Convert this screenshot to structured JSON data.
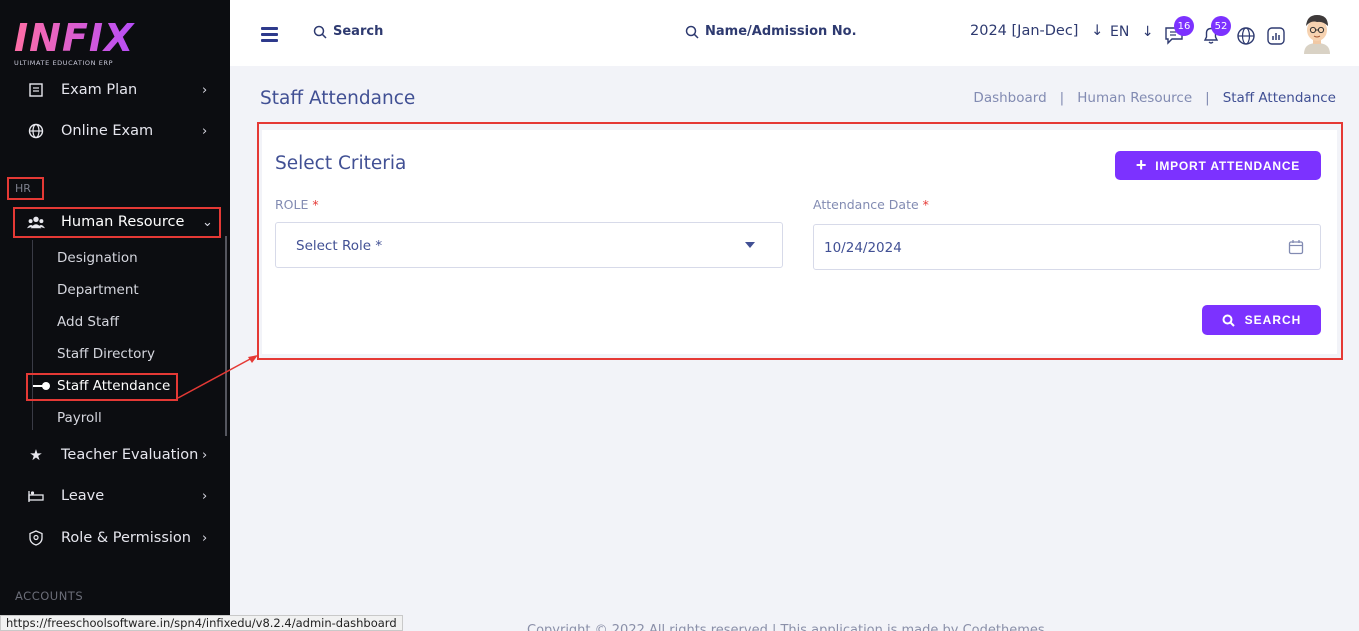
{
  "logo": {
    "main": "INFIX",
    "sub": "ULTIMATE EDUCATION ERP"
  },
  "sidebar": {
    "items_top": [
      {
        "label": "Exam Plan",
        "icon": "exam-plan-icon"
      },
      {
        "label": "Online Exam",
        "icon": "globe-icon"
      }
    ],
    "section_hr": "HR",
    "human_resource": {
      "label": "Human Resource",
      "icon": "users-icon"
    },
    "sub_items": [
      "Designation",
      "Department",
      "Add Staff",
      "Staff Directory",
      "Staff Attendance",
      "Payroll"
    ],
    "items_bottom": [
      {
        "label": "Teacher Evaluation",
        "icon": "star-icon"
      },
      {
        "label": "Leave",
        "icon": "leave-icon"
      },
      {
        "label": "Role & Permission",
        "icon": "permission-icon"
      }
    ],
    "section_accounts": "ACCOUNTS"
  },
  "topbar": {
    "search_label": "Search",
    "name_search_label": "Name/Admission No.",
    "year": "2024 [Jan-Dec]",
    "year_arrow": "↓",
    "lang": "EN",
    "lang_arrow": "↓",
    "chat_badge": "16",
    "notif_badge": "52"
  },
  "page": {
    "title": "Staff Attendance",
    "breadcrumb": [
      "Dashboard",
      "Human Resource",
      "Staff Attendance"
    ]
  },
  "criteria": {
    "title": "Select Criteria",
    "import_label": "IMPORT ATTENDANCE",
    "role_label": "ROLE",
    "role_placeholder": "Select Role *",
    "date_label": "Attendance Date",
    "required_mark": "*",
    "date_value": "10/24/2024",
    "search_label": "SEARCH"
  },
  "footer": "Copyright © 2022 All rights reserved | This application is made by Codethemes",
  "status_url": "https://freeschoolsoftware.in/spn4/infixedu/v8.2.4/admin-dashboard",
  "colors": {
    "accent": "#7c32ff",
    "sidebar_bg": "#0c0d11",
    "highlight": "#e53935",
    "text": "#415094"
  }
}
